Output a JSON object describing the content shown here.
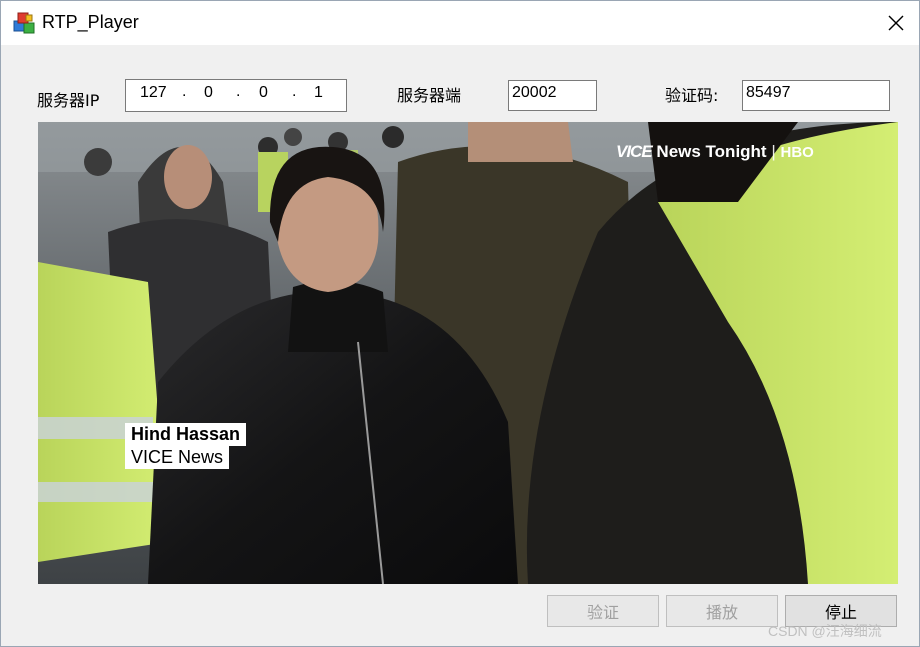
{
  "window": {
    "title": "RTP_Player",
    "app_icon": "app-cubes-icon",
    "close_icon": "close-icon"
  },
  "form": {
    "ip_label": "服务器IP",
    "ip_octets": [
      "127",
      "0",
      "0",
      "1"
    ],
    "port_label": "服务器端",
    "port_value": "20002",
    "code_label": "验证码:",
    "code_value": "85497"
  },
  "video": {
    "logo_vice": "VICE",
    "logo_news": "News Tonight",
    "logo_hbo": "HBO",
    "lower_third_name": "Hind Hassan",
    "lower_third_org": "VICE News"
  },
  "buttons": {
    "verify_label": "验证",
    "play_label": "播放",
    "stop_label": "停止"
  },
  "watermark": "CSDN @汪海细流",
  "colors": {
    "vest": "#cbe866",
    "accent": "#0078d7"
  }
}
